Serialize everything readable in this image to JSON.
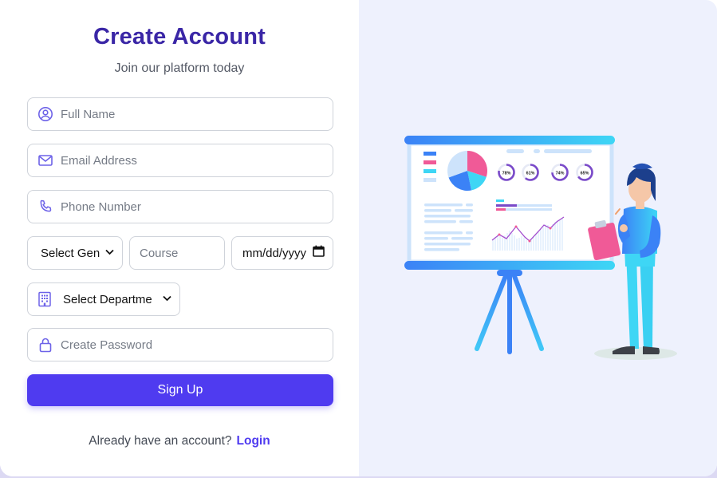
{
  "form": {
    "title": "Create Account",
    "subtitle": "Join our platform today",
    "full_name_placeholder": "Full Name",
    "email_placeholder": "Email Address",
    "phone_placeholder": "Phone Number",
    "gender_selected": "Select Gen",
    "course_placeholder": "Course",
    "date_placeholder": "mm/dd/yyyy",
    "department_selected": "Select Departme",
    "password_placeholder": "Create Password",
    "signup_label": "Sign Up",
    "footer_text": "Already have an account?",
    "login_label": "Login"
  },
  "illustration": {
    "percentages": [
      "78%",
      "61%",
      "74%",
      "65%"
    ]
  },
  "colors": {
    "accent": "#4f3bf0",
    "title": "#3a26a6",
    "panel_bg": "#eef1fd"
  }
}
